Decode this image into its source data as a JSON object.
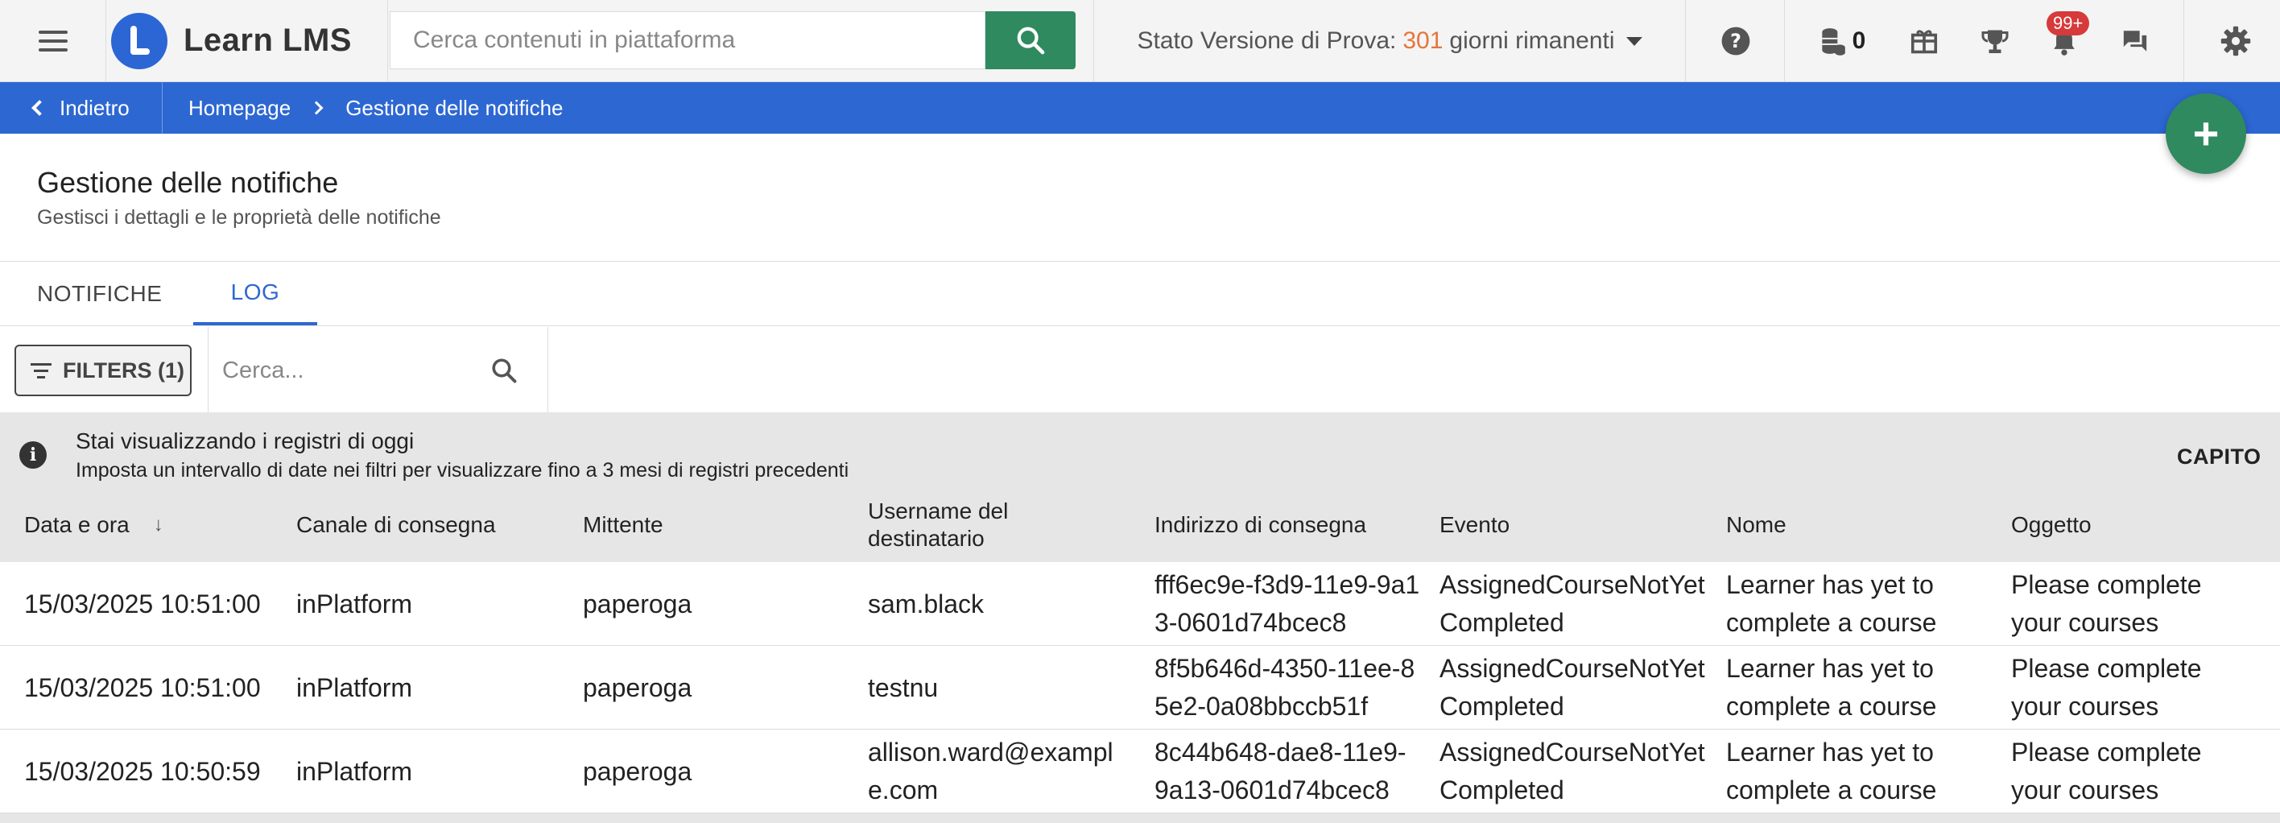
{
  "topbar": {
    "logo_text": "Learn LMS",
    "search_placeholder": "Cerca contenuti in piattaforma",
    "trial_label": "Stato Versione di Prova:",
    "trial_days": "301",
    "trial_suffix": "giorni rimanenti",
    "coins_count": "0",
    "notifications_badge": "99+"
  },
  "breadcrumb": {
    "back_label": "Indietro",
    "items": [
      "Homepage",
      "Gestione delle notifiche"
    ]
  },
  "page": {
    "title": "Gestione delle notifiche",
    "subtitle": "Gestisci i dettagli e le proprietà delle notifiche"
  },
  "tabs": [
    {
      "label": "NOTIFICHE",
      "active": false
    },
    {
      "label": "LOG",
      "active": true
    }
  ],
  "filters": {
    "button_label": "FILTERS (1)",
    "search_placeholder": "Cerca..."
  },
  "banner": {
    "title": "Stai visualizzando i registri di oggi",
    "text": "Imposta un intervallo di date nei filtri per visualizzare fino a 3 mesi di registri precedenti",
    "action": "CAPITO"
  },
  "table": {
    "columns": [
      "Data e ora",
      "Canale di consegna",
      "Mittente",
      "Username del destinatario",
      "Indirizzo di consegna",
      "Evento",
      "Nome",
      "Oggetto"
    ],
    "rows": [
      [
        "15/03/2025 10:51:00",
        "inPlatform",
        "paperoga",
        "sam.black",
        "fff6ec9e-f3d9-11e9-9a13-0601d74bcec8",
        "AssignedCourseNotYetCompleted",
        "Learner has yet to complete a course",
        "Please complete your courses"
      ],
      [
        "15/03/2025 10:51:00",
        "inPlatform",
        "paperoga",
        "testnu",
        "8f5b646d-4350-11ee-85e2-0a08bbccb51f",
        "AssignedCourseNotYetCompleted",
        "Learner has yet to complete a course",
        "Please complete your courses"
      ],
      [
        "15/03/2025 10:50:59",
        "inPlatform",
        "paperoga",
        "allison.ward@example.com",
        "8c44b648-dae8-11e9-9a13-0601d74bcec8",
        "AssignedCourseNotYetCompleted",
        "Learner has yet to complete a course",
        "Please complete your courses"
      ]
    ]
  },
  "colors": {
    "brand_blue": "#2d67d2",
    "accent_green": "#2f8a5f",
    "trial_orange": "#e8743b",
    "badge_red": "#d63a3a"
  }
}
